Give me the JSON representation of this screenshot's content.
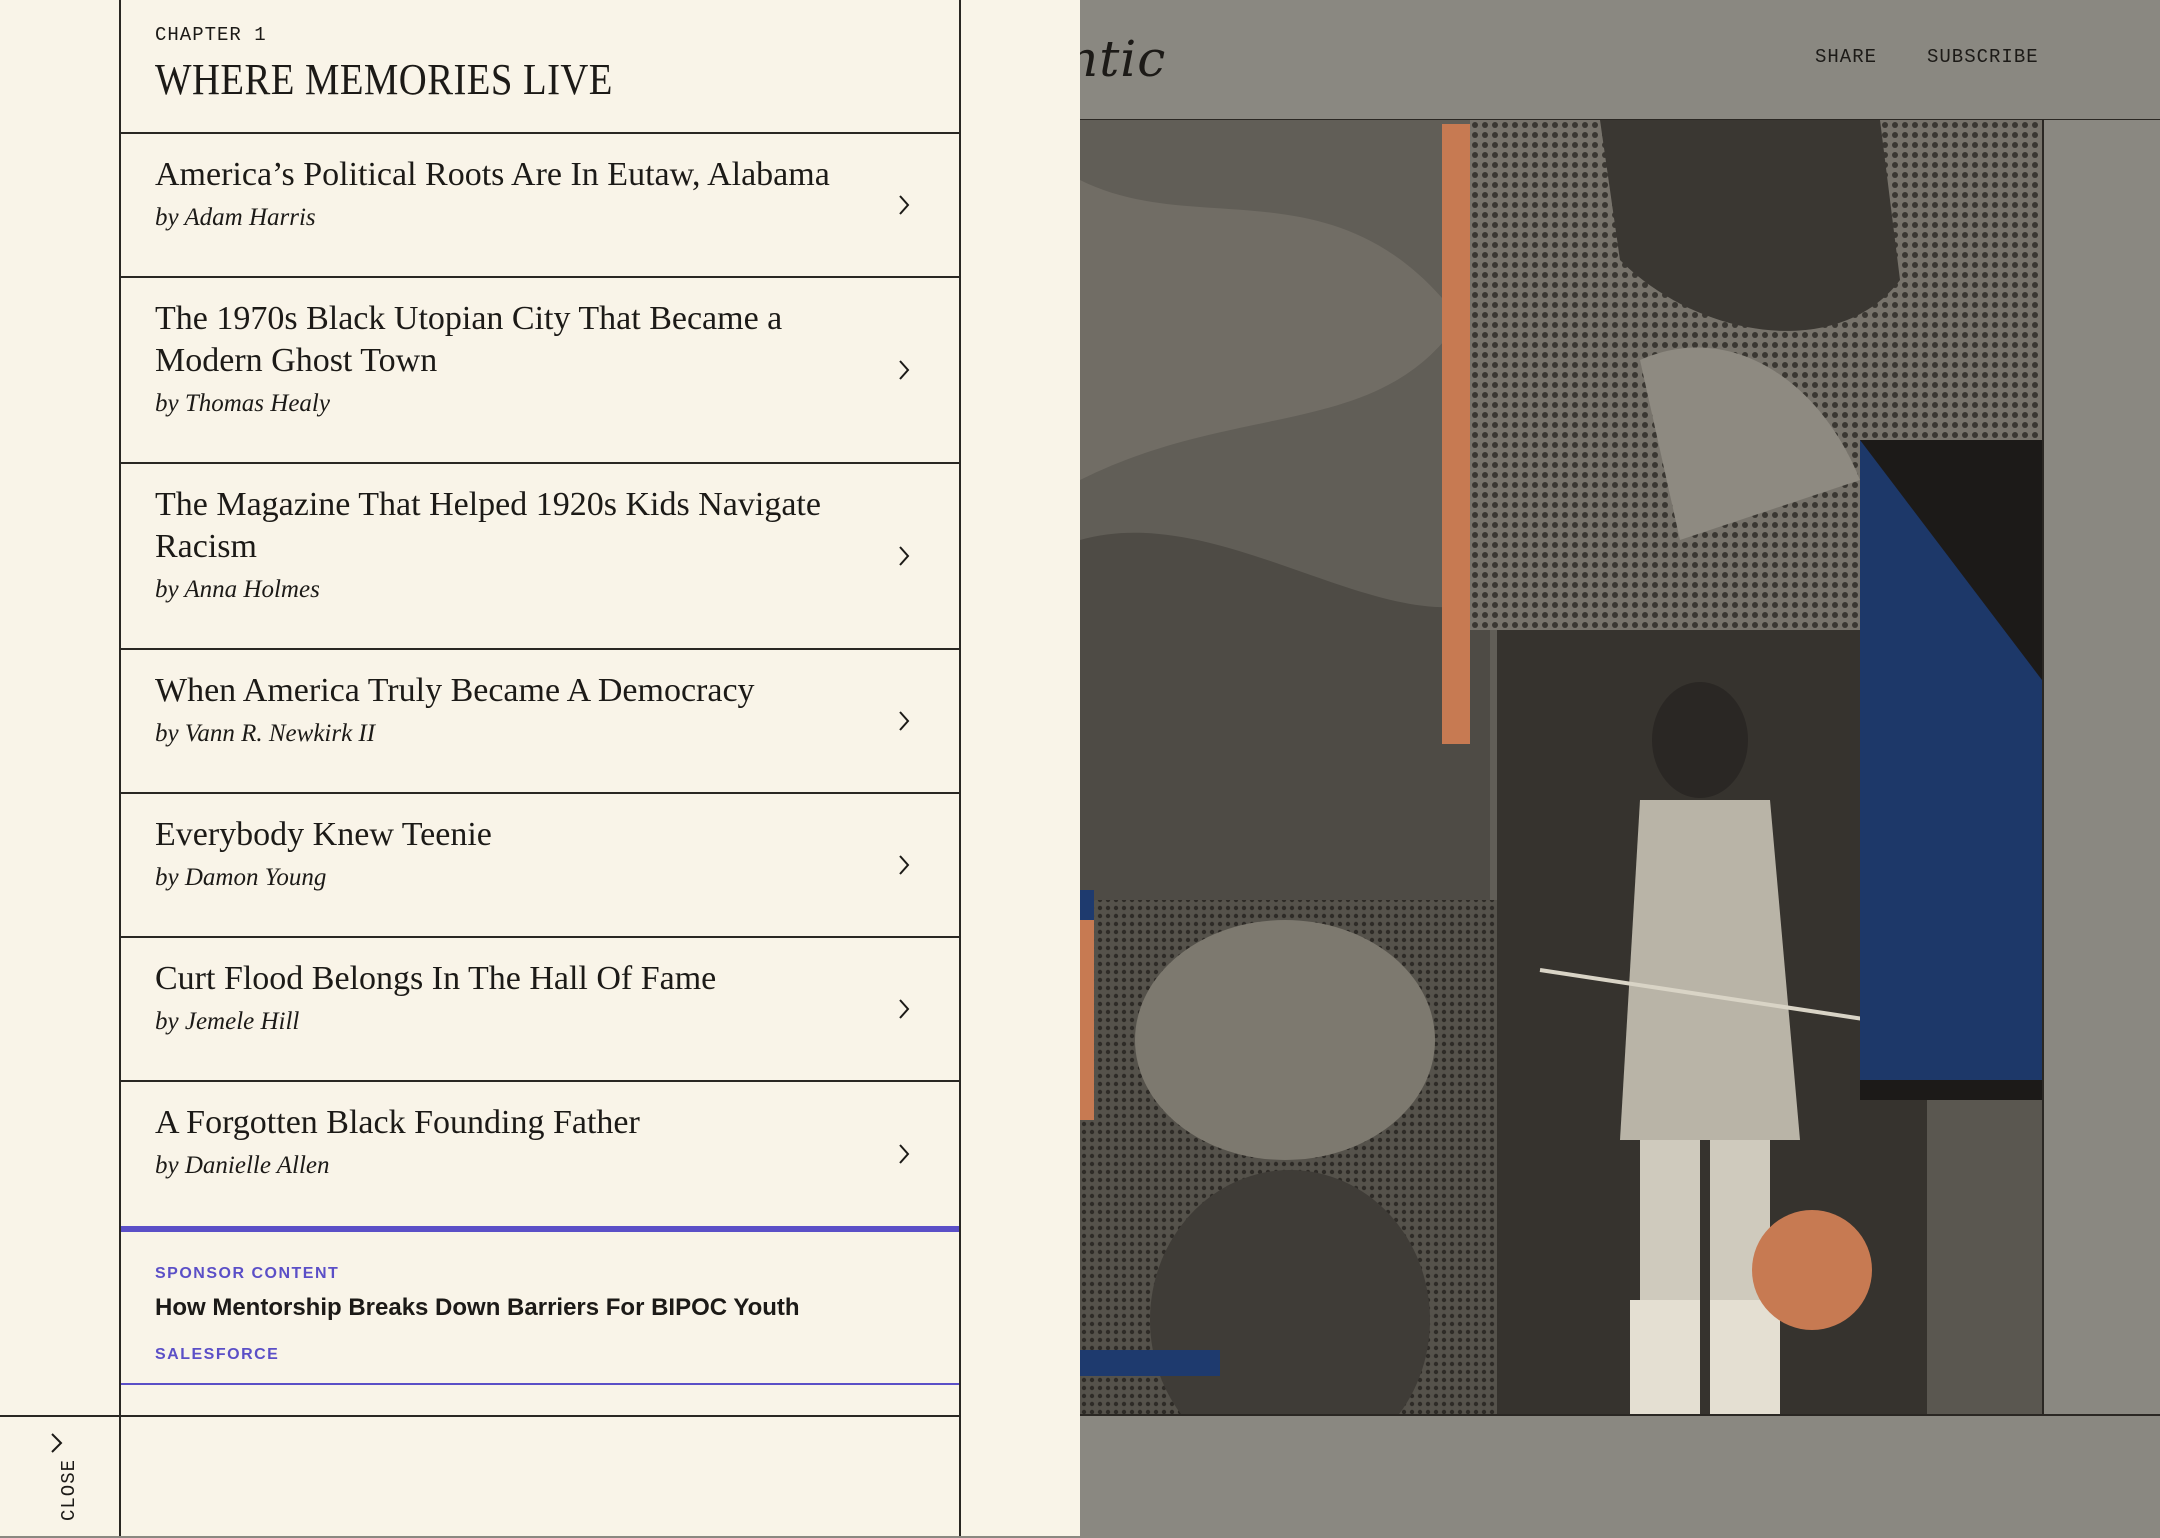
{
  "header": {
    "logo_fragment": "ntic",
    "share_label": "SHARE",
    "subscribe_label": "SUBSCRIBE"
  },
  "drawer": {
    "chapter_label": "CHAPTER 1",
    "chapter_title": "WHERE MEMORIES LIVE",
    "close_label": "CLOSE",
    "items": [
      {
        "title": "America’s Political Roots Are In Eutaw, Alabama",
        "byline": "by Adam Harris"
      },
      {
        "title": "The 1970s Black Utopian City That Became a Modern Ghost Town",
        "byline": "by Thomas Healy"
      },
      {
        "title": "The Magazine That Helped 1920s Kids Navigate Racism",
        "byline": "by Anna Holmes"
      },
      {
        "title": "When America Truly Became A Democracy",
        "byline": "by Vann R. Newkirk II"
      },
      {
        "title": "Everybody Knew Teenie",
        "byline": "by Damon Young"
      },
      {
        "title": "Curt Flood Belongs In The Hall Of Fame",
        "byline": "by Jemele Hill"
      },
      {
        "title": "A Forgotten Black Founding Father",
        "byline": "by Danielle Allen"
      }
    ],
    "sponsor": {
      "label": "SPONSOR CONTENT",
      "headline": "How Mentorship Breaks Down Barriers For BIPOC Youth",
      "brand": "SALESFORCE"
    }
  },
  "colors": {
    "drawer_bg": "#f9f4e8",
    "page_bg": "#8a8881",
    "ink": "#1c1a17",
    "sponsor_accent": "#5b4fc7",
    "art_orange": "#c77a52",
    "art_blue": "#1e3a6e"
  },
  "icons": {
    "toc_item": "chevron-right-icon",
    "close": "chevron-right-icon"
  }
}
